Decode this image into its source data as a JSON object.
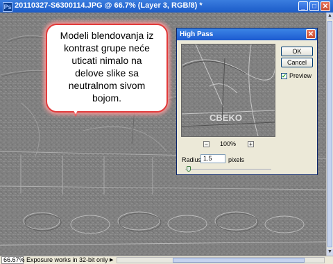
{
  "window": {
    "title": "20110327-S6300114.JPG @ 66.7% (Layer 3, RGB/8) *",
    "app_icon": "photoshop-icon",
    "minimize_glyph": "_",
    "maximize_glyph": "□",
    "close_glyph": "✕"
  },
  "callout": {
    "lines": [
      "Modeli blendovanja iz",
      "kontrast grupe neće",
      "uticati nimalo na",
      "delove slike sa",
      "neutralnom sivom",
      "bojom."
    ]
  },
  "dialog": {
    "title": "High Pass",
    "close_glyph": "✕",
    "ok_label": "OK",
    "cancel_label": "Cancel",
    "preview_label": "Preview",
    "preview_checked": true,
    "check_glyph": "✔",
    "zoom_out_glyph": "−",
    "zoom_in_glyph": "+",
    "zoom_level": "100%",
    "radius_label": "Radius:",
    "radius_value": "1.5",
    "radius_unit": "pixels",
    "slider_fraction": 0.02,
    "preview_text": "CBEKO"
  },
  "status": {
    "zoom": "66.67%",
    "info": "Exposure works in 32-bit only",
    "play_glyph": "▶"
  },
  "scroll": {
    "up_glyph": "▲",
    "down_glyph": "▼"
  },
  "colors": {
    "canvas_gray": "#808080",
    "callout_border": "#e23a3a",
    "titlebar_blue": "#1b5bc8"
  }
}
